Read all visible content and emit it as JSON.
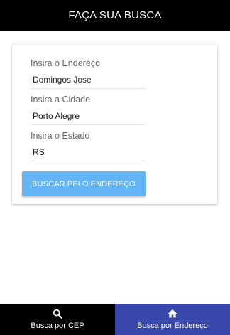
{
  "app_bar": {
    "title": "FAÇA SUA BUSCA"
  },
  "form": {
    "endereco": {
      "label": "Insira o Endereço",
      "value": "Domingos Jose"
    },
    "cidade": {
      "label": "Insira a Cidade",
      "value": "Porto Alegre"
    },
    "estado": {
      "label": "Insira o Estado",
      "value": "RS"
    },
    "search_button": "BUSCAR PELO ENDEREÇO"
  },
  "bottom_nav": {
    "items": [
      {
        "label": "Busca por CEP",
        "icon": "search-icon",
        "active": false
      },
      {
        "label": "Busca por Endereço",
        "icon": "home-icon",
        "active": true
      }
    ]
  },
  "colors": {
    "app_bar": "#000000",
    "button": "#64b5f6",
    "nav_active": "#3949ab",
    "nav_inactive": "#000000"
  }
}
